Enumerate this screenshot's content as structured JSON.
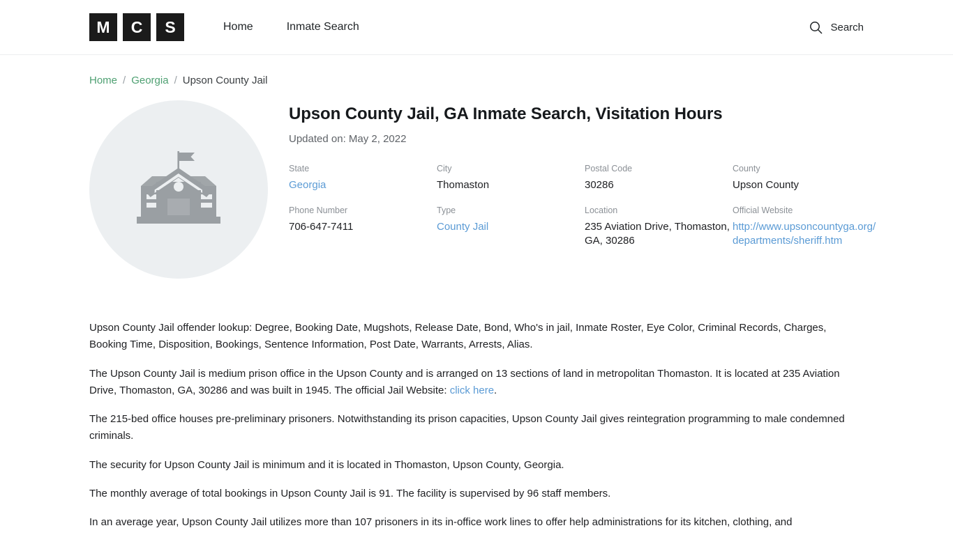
{
  "header": {
    "logo_letters": [
      "M",
      "C",
      "S"
    ],
    "nav": [
      {
        "label": "Home"
      },
      {
        "label": "Inmate Search"
      }
    ],
    "search_label": "Search",
    "search_icon": "search-icon"
  },
  "breadcrumb": {
    "items": [
      {
        "label": "Home",
        "link": true
      },
      {
        "label": "Georgia",
        "link": true
      },
      {
        "label": "Upson County Jail",
        "link": false
      }
    ],
    "separator": "/"
  },
  "facility": {
    "thumb_icon": "government-building-icon",
    "title": "Upson County Jail, GA Inmate Search, Visitation Hours",
    "updated": "Updated on: May 2, 2022",
    "info": [
      {
        "label": "State",
        "value": "Georgia",
        "link": true
      },
      {
        "label": "City",
        "value": "Thomaston",
        "link": false
      },
      {
        "label": "Postal Code",
        "value": "30286",
        "link": false
      },
      {
        "label": "County",
        "value": "Upson County",
        "link": false
      },
      {
        "label": "Phone Number",
        "value": "706-647-7411",
        "link": false
      },
      {
        "label": "Type",
        "value": "County Jail",
        "link": true
      },
      {
        "label": "Location",
        "value": "235 Aviation Drive, Thomaston, GA, 30286",
        "link": false
      },
      {
        "label": "Official Website",
        "value": "http://www.upsoncountyga.org/departments/sheriff.htm",
        "link": true
      }
    ]
  },
  "article": {
    "p1": "Upson County Jail offender lookup: Degree, Booking Date, Mugshots, Release Date, Bond, Who's in jail, Inmate Roster, Eye Color, Criminal Records, Charges, Booking Time, Disposition, Bookings, Sentence Information, Post Date, Warrants, Arrests, Alias.",
    "p2_before": "The Upson County Jail is medium prison office in the Upson County and is arranged on 13 sections of land in metropolitan Thomaston. It is located at 235 Aviation Drive, Thomaston, GA, 30286 and was built in 1945. The official Jail Website: ",
    "p2_link": "click here",
    "p2_after": ".",
    "p3": "The 215-bed office houses pre-preliminary prisoners. Notwithstanding its prison capacities, Upson County Jail gives reintegration programming to male condemned criminals.",
    "p4": "The security for Upson County Jail is minimum and it is located in Thomaston, Upson County, Georgia.",
    "p5": "The monthly average of total bookings in Upson County Jail is 91. The facility is supervised by 96 staff members.",
    "p6": "In an average year, Upson County Jail utilizes more than 107 prisoners in its in-office work lines to offer help administrations for its kitchen, clothing, and"
  },
  "colors": {
    "breadcrumb_link": "#4ea072",
    "body_link": "#5b9bd5",
    "logo_bg": "#1b1b1b",
    "thumb_bg": "#eceff1",
    "icon_gray": "#9a9fa3"
  }
}
